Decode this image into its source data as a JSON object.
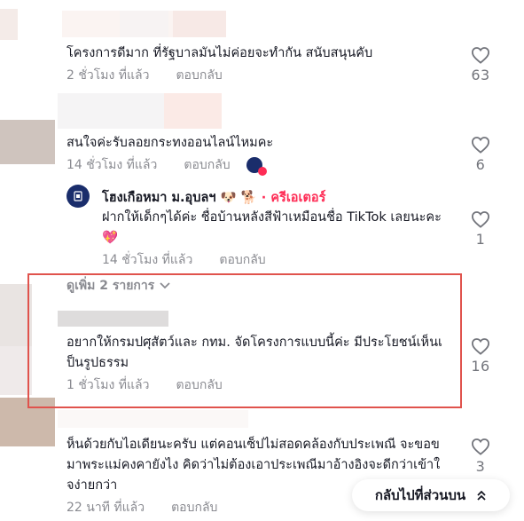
{
  "colors": {
    "text": "#161823",
    "muted": "#8a8b91",
    "creator_accent": "#fe2c55",
    "highlight_border": "#e0534d"
  },
  "comments": [
    {
      "text_lines": [
        "โครงการดีมาก ที่รัฐบาลมันไม่ค่อยจะทำกัน สนับสนุนคับ"
      ],
      "time": "2 ชั่วโมง ที่แล้ว",
      "reply_label": "ตอบกลับ",
      "likes": "63"
    },
    {
      "text_lines": [
        "สนใจค่ะรับลอยกระทงออนไลน์ไหมคะ"
      ],
      "time": "14 ชั่วโมง ที่แล้ว",
      "reply_label": "ตอบกลับ",
      "likes": "6"
    },
    {
      "author": "โฮงเกือหมา ม.อุบลฯ",
      "author_emojis": "🐶 🐕",
      "badge": "· ครีเอเตอร์",
      "text_lines": [
        "ฝากให้เด็กๆได้ค่ะ ชื่อบ้านหลังสีฟ้าเหมือนชื่อ TikTok เลยนะคะ",
        "💖"
      ],
      "time": "14 ชั่วโมง ที่แล้ว",
      "reply_label": "ตอบกลับ",
      "likes": "1"
    },
    {
      "text_lines": [
        "อยากให้กรมปศุสัตว์และ กทม. จัดโครงการแบบนี้ค่ะ มีประโยชน์เห็นเ",
        "ป็นรูปธรรม"
      ],
      "time": "1 ชั่วโมง ที่แล้ว",
      "reply_label": "ตอบกลับ",
      "likes": "16"
    },
    {
      "text_lines": [
        "ห็นด้วยกับไอเดียนะครับ แต่คอนเซ็ปไม่สอดคล้องกับประเพณี จะขอข",
        "มาพระแม่คงคายังไง คิดว่าไม่ต้องเอาประเพณีมาอ้างอิงจะดีกว่าเข้าใ",
        "จง่ายกว่า"
      ],
      "time": "22 นาที ที่แล้ว",
      "reply_label": "ตอบกลับ",
      "likes": "3"
    }
  ],
  "see_more": "ดูเพิ่ม 2 รายการ",
  "back_to_top": "กลับไปที่ส่วนบน"
}
